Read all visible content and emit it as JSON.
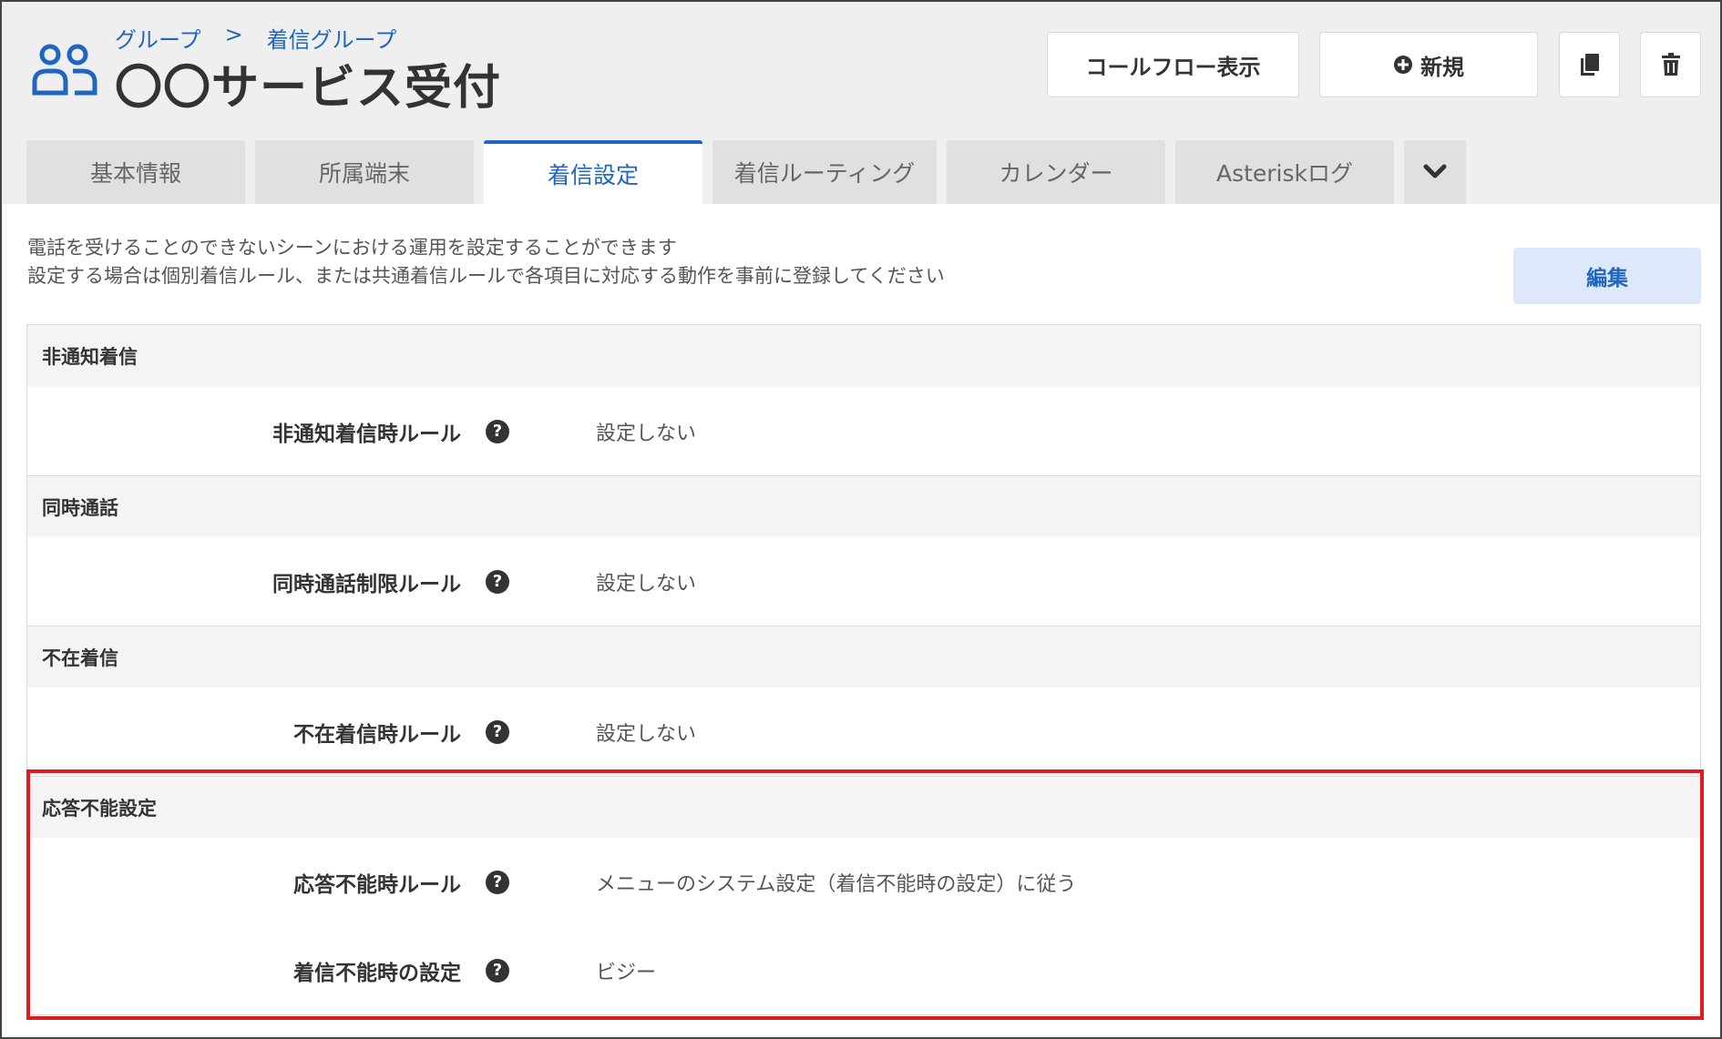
{
  "breadcrumb": {
    "items": [
      "グループ",
      ">",
      "着信グループ"
    ]
  },
  "title": "〇〇サービス受付",
  "header": {
    "callflow_label": "コールフロー表示",
    "new_label": "新規",
    "copy_icon": "copy-icon",
    "delete_icon": "trash-icon"
  },
  "tabs": [
    {
      "label": "基本情報"
    },
    {
      "label": "所属端末"
    },
    {
      "label": "着信設定",
      "active": true
    },
    {
      "label": "着信ルーティング"
    },
    {
      "label": "カレンダー"
    },
    {
      "label": "Asteriskログ"
    }
  ],
  "description": {
    "line1": "電話を受けることのできないシーンにおける運用を設定することができます",
    "line2": "設定する場合は個別着信ルール、または共通着信ルールで各項目に対応する動作を事前に登録してください"
  },
  "edit_label": "編集",
  "sections": [
    {
      "title": "非通知着信",
      "rows": [
        {
          "label": "非通知着信時ルール",
          "value": "設定しない"
        }
      ]
    },
    {
      "title": "同時通話",
      "rows": [
        {
          "label": "同時通話制限ルール",
          "value": "設定しない"
        }
      ]
    },
    {
      "title": "不在着信",
      "rows": [
        {
          "label": "不在着信時ルール",
          "value": "設定しない"
        }
      ]
    },
    {
      "title": "応答不能設定",
      "rows": [
        {
          "label": "応答不能時ルール",
          "value": "メニューのシステム設定（着信不能時の設定）に従う"
        },
        {
          "label": "着信不能時の設定",
          "value": "ビジー"
        }
      ]
    }
  ],
  "colors": {
    "accent": "#1f66c1",
    "highlight_border": "#e01b1b",
    "edit_button_bg": "#dde8fb"
  }
}
